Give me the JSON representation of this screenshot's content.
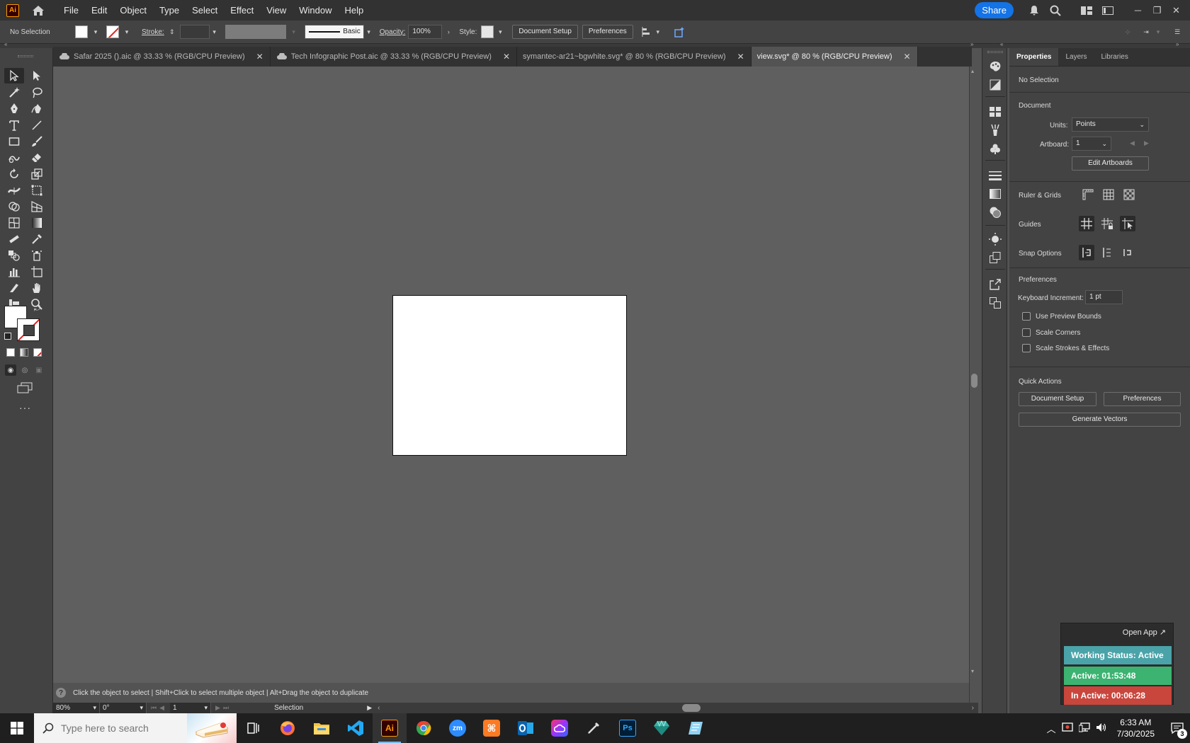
{
  "menubar": {
    "logo": "Ai",
    "items": [
      "File",
      "Edit",
      "Object",
      "Type",
      "Select",
      "Effect",
      "View",
      "Window",
      "Help"
    ],
    "share_label": "Share"
  },
  "control": {
    "selection": "No Selection",
    "stroke_label": "Stroke:",
    "brush_label": "Basic",
    "opacity_label": "Opacity:",
    "opacity_value": "100%",
    "style_label": "Style:",
    "doc_setup": "Document Setup",
    "preferences": "Preferences"
  },
  "tabs": [
    {
      "label": "Safar 2025 ().aic @ 33.33 % (RGB/CPU Preview)",
      "cloud": true,
      "active": false
    },
    {
      "label": "Tech Infographic Post.aic @ 33.33 % (RGB/CPU Preview)",
      "cloud": true,
      "active": false
    },
    {
      "label": "symantec-ar21~bgwhite.svg* @ 80 % (RGB/CPU Preview)",
      "cloud": false,
      "active": false
    },
    {
      "label": "view.svg* @ 80 % (RGB/CPU Preview)",
      "cloud": false,
      "active": true
    }
  ],
  "hint": {
    "icon": "?",
    "text": "Click the object to select  |  Shift+Click to select multiple object  |  Alt+Drag the object to duplicate"
  },
  "status": {
    "zoom": "80%",
    "rotation": "0°",
    "artboard": "1",
    "tool": "Selection"
  },
  "panel": {
    "tabs": [
      "Properties",
      "Layers",
      "Libraries"
    ],
    "selection": "No Selection",
    "document_heading": "Document",
    "units_label": "Units:",
    "units_value": "Points",
    "artboard_label": "Artboard:",
    "artboard_value": "1",
    "edit_artboards": "Edit Artboards",
    "ruler_label": "Ruler & Grids",
    "guides_label": "Guides",
    "snap_label": "Snap Options",
    "prefs_heading": "Preferences",
    "keyboard_label": "Keyboard Increment:",
    "keyboard_value": "1 pt",
    "chk_preview": "Use Preview Bounds",
    "chk_corners": "Scale Corners",
    "chk_strokes": "Scale Strokes & Effects",
    "quick_heading": "Quick Actions",
    "qa_doc_setup": "Document Setup",
    "qa_prefs": "Preferences",
    "qa_generate": "Generate Vectors"
  },
  "tracker": {
    "open_app": "Open App ↗",
    "working": "Working Status: Active",
    "active": "Active: 01:53:48",
    "inactive": "In Active: 00:06:28"
  },
  "taskbar": {
    "search_placeholder": "Type here to search",
    "time": "6:33 AM",
    "date": "7/30/2025",
    "notif_count": "3"
  },
  "colors": {
    "accent": "#1473e6",
    "working": "#4aa3a8",
    "active": "#3cb371",
    "inactive": "#c9463d"
  }
}
